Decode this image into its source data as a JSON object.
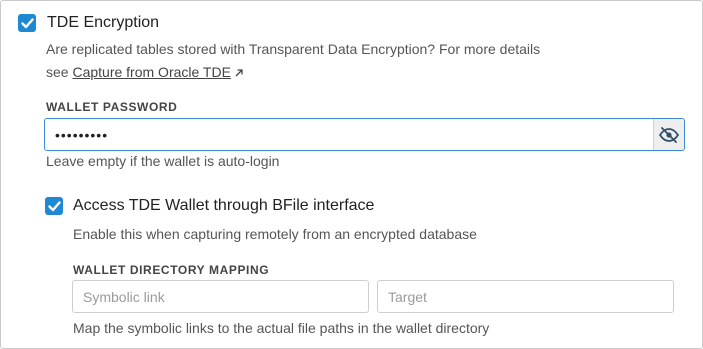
{
  "colors": {
    "accent": "#1f88d2",
    "input_focus": "#3a8ad6"
  },
  "tde": {
    "checked": true,
    "title": "TDE Encryption",
    "desc_line1": "Are replicated tables stored with Transparent Data Encryption? For more details",
    "desc_prefix": "see",
    "link_label": "Capture from Oracle TDE",
    "link_icon": "external-link-icon"
  },
  "wallet_password": {
    "label": "WALLET PASSWORD",
    "value": "•••••••••",
    "toggle_icon": "eye-slash-icon",
    "hint": "Leave empty if the wallet is auto-login"
  },
  "bfile": {
    "checked": true,
    "title": "Access TDE Wallet through BFile interface",
    "desc": "Enable this when capturing remotely from an encrypted database"
  },
  "mapping": {
    "label": "WALLET DIRECTORY MAPPING",
    "symbolic_placeholder": "Symbolic link",
    "target_placeholder": "Target",
    "hint": "Map the symbolic links to the actual file paths in the wallet directory"
  }
}
